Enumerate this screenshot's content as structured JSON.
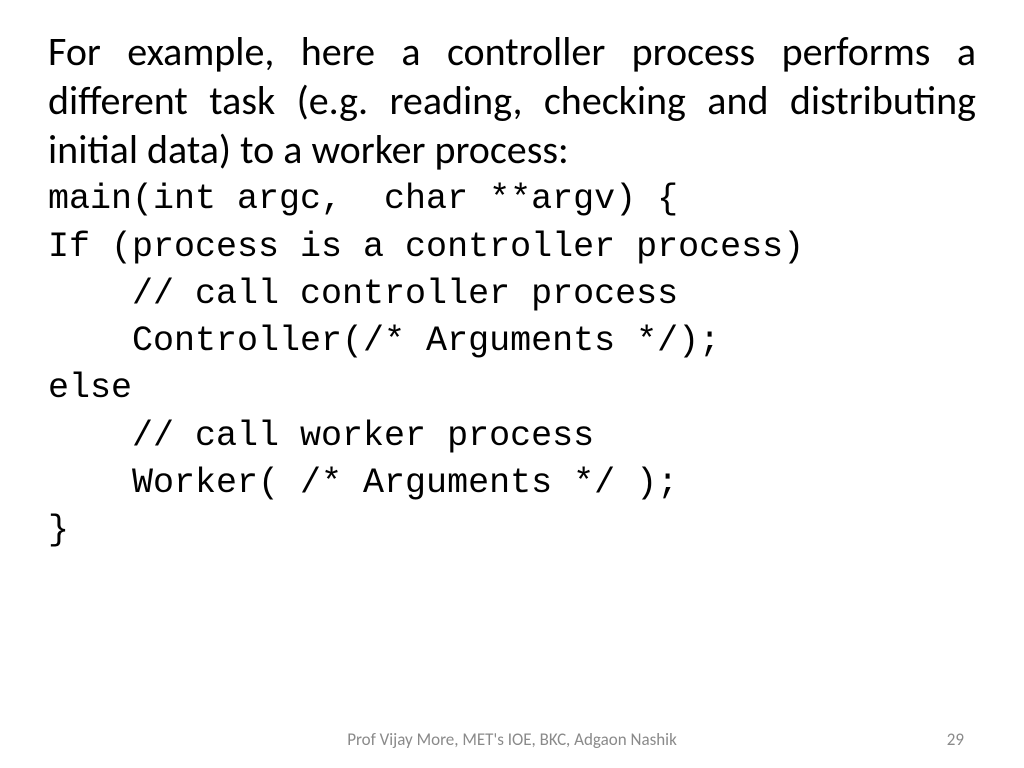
{
  "slide": {
    "body": "For example, here a controller process performs a different task (e.g. reading, checking and distributing initial data) to a worker process:",
    "code": "main(int argc,  char **argv) {\nIf (process is a controller process)\n    // call controller process\n    Controller(/* Arguments */);\nelse\n    // call worker process\n    Worker( /* Arguments */ );\n}",
    "footer": "Prof Vijay More, MET's IOE, BKC, Adgaon Nashik",
    "page_number": "29"
  }
}
